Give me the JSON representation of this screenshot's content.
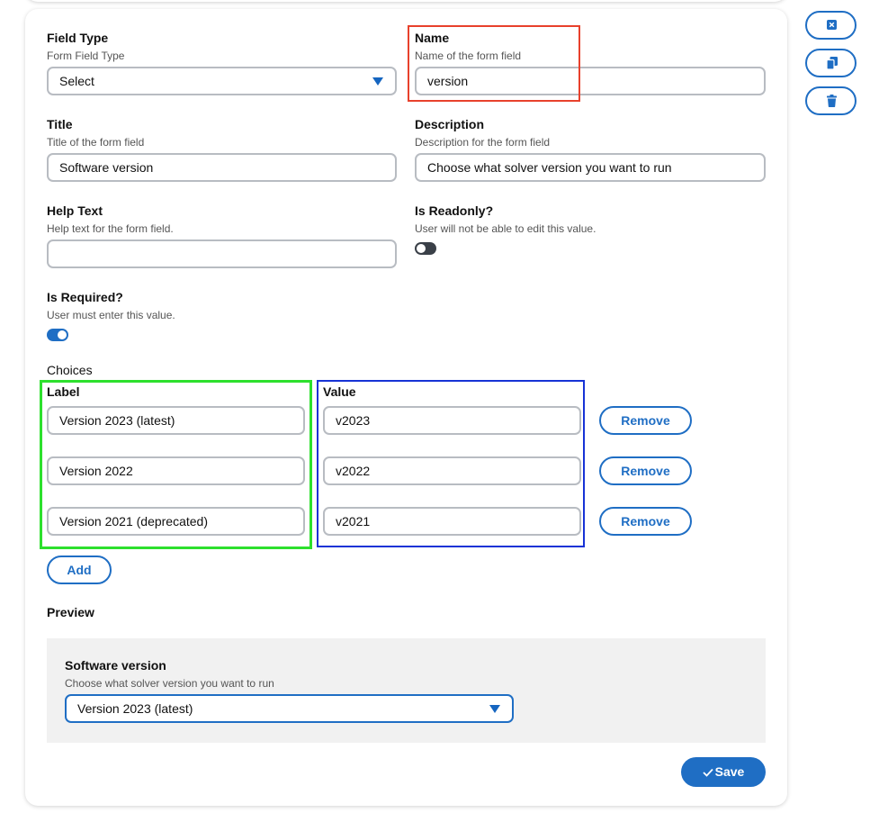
{
  "form": {
    "field_type": {
      "label": "Field Type",
      "help": "Form Field Type",
      "value": "Select"
    },
    "name": {
      "label": "Name",
      "help": "Name of the form field",
      "value": "version"
    },
    "title": {
      "label": "Title",
      "help": "Title of the form field",
      "value": "Software version"
    },
    "description": {
      "label": "Description",
      "help": "Description for the form field",
      "value": "Choose what solver version you want to run"
    },
    "help_text": {
      "label": "Help Text",
      "help": "Help text for the form field.",
      "value": ""
    },
    "is_readonly": {
      "label": "Is Readonly?",
      "help": "User will not be able to edit this value.",
      "on": false
    },
    "is_required": {
      "label": "Is Required?",
      "help": "User must enter this value.",
      "on": true
    }
  },
  "choices": {
    "heading": "Choices",
    "label_header": "Label",
    "value_header": "Value",
    "remove_label": "Remove",
    "add_label": "Add",
    "rows": [
      {
        "label": "Version 2023 (latest)",
        "value": "v2023"
      },
      {
        "label": "Version 2022",
        "value": "v2022"
      },
      {
        "label": "Version 2021 (deprecated)",
        "value": "v2021"
      }
    ]
  },
  "preview": {
    "heading": "Preview",
    "title": "Software version",
    "description": "Choose what solver version you want to run",
    "selected": "Version 2023 (latest)"
  },
  "actions": {
    "save_label": "Save"
  },
  "side_actions": [
    "close-icon",
    "copy-icon",
    "trash-icon"
  ],
  "colors": {
    "accent": "#1f6ec4",
    "highlight_red": "#e8412c",
    "highlight_green": "#2de02d",
    "highlight_blue": "#1733d6",
    "toggle_off": "#3a4048"
  }
}
